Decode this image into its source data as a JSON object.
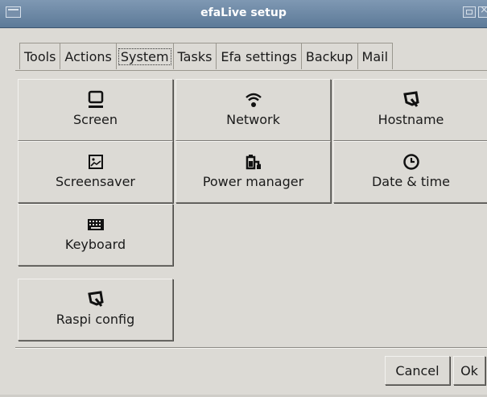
{
  "window": {
    "title": "efaLive setup"
  },
  "tabs": [
    {
      "label": "Tools"
    },
    {
      "label": "Actions"
    },
    {
      "label": "System",
      "active": true
    },
    {
      "label": "Tasks"
    },
    {
      "label": "Efa settings"
    },
    {
      "label": "Backup"
    },
    {
      "label": "Mail"
    }
  ],
  "tiles": [
    {
      "label": "Screen",
      "icon": "monitor-icon"
    },
    {
      "label": "Network",
      "icon": "wifi-icon"
    },
    {
      "label": "Hostname",
      "icon": "raspberry-icon"
    },
    {
      "label": "Screensaver",
      "icon": "image-icon"
    },
    {
      "label": "Power manager",
      "icon": "battery-plug-icon"
    },
    {
      "label": "Date & time",
      "icon": "clock-icon"
    },
    {
      "label": "Keyboard",
      "icon": "keyboard-icon"
    },
    {
      "label": "Raspi config",
      "icon": "raspberry-icon"
    }
  ],
  "buttons": {
    "cancel": "Cancel",
    "ok": "Ok"
  }
}
